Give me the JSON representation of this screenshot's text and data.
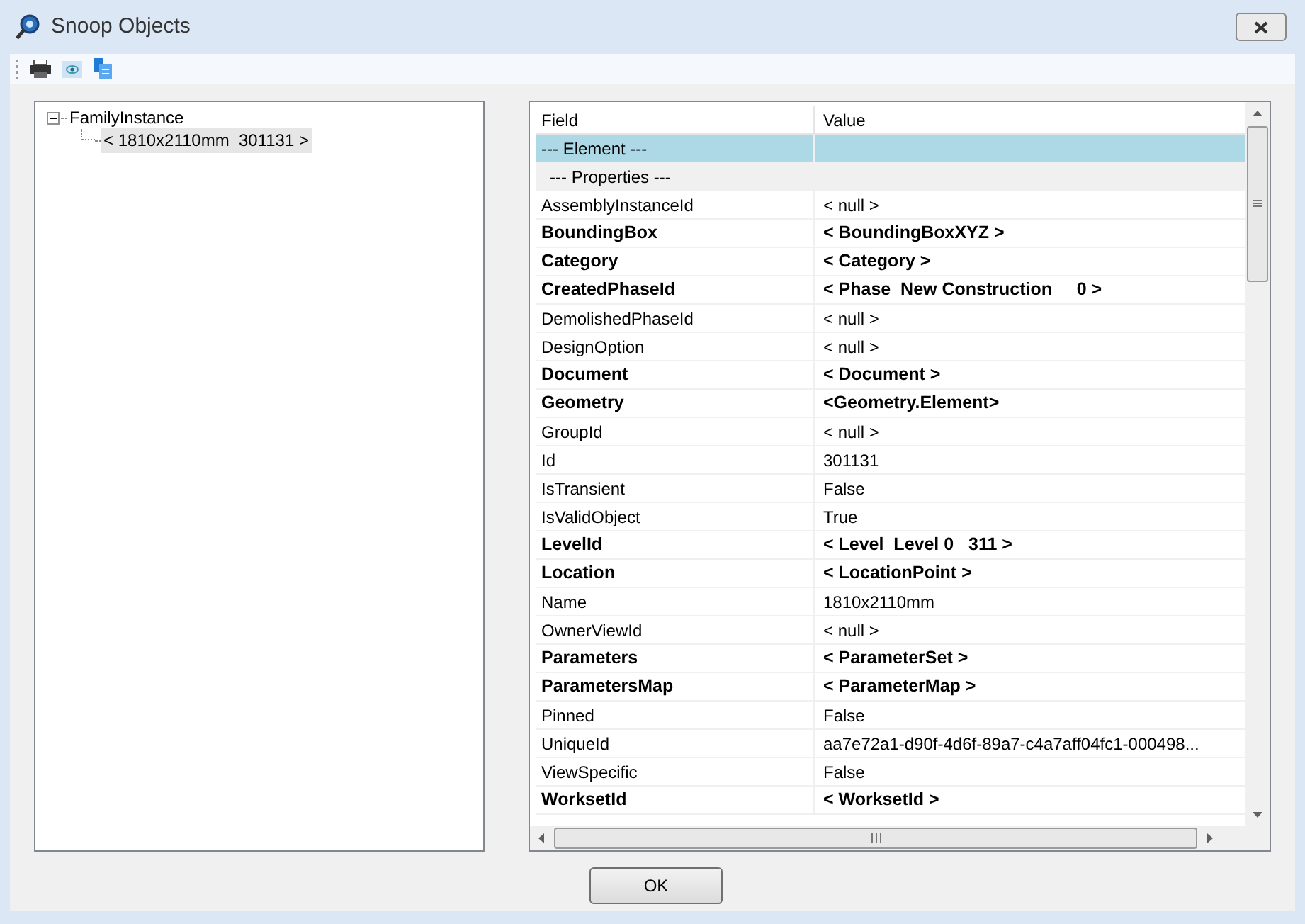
{
  "window": {
    "title": "Snoop Objects"
  },
  "tree": [
    {
      "label": "FamilyInstance",
      "expanded": true,
      "selected": false,
      "children": [
        {
          "label": "< 1810x2110mm  301131 >",
          "selected": true
        }
      ]
    }
  ],
  "table": {
    "columns": [
      "Field",
      "Value"
    ],
    "rows": [
      {
        "kind": "section",
        "selected": true,
        "field": "--- Element ---",
        "value": ""
      },
      {
        "kind": "subsection",
        "selected": false,
        "field": "--- Properties ---",
        "value": ""
      },
      {
        "kind": "plain",
        "selected": false,
        "field": "AssemblyInstanceId",
        "value": "< null >"
      },
      {
        "kind": "object",
        "selected": false,
        "field": "BoundingBox",
        "value": "< BoundingBoxXYZ >"
      },
      {
        "kind": "object",
        "selected": false,
        "field": "Category",
        "value": "< Category >"
      },
      {
        "kind": "object",
        "selected": false,
        "field": "CreatedPhaseId",
        "value": "< Phase  New Construction     0 >"
      },
      {
        "kind": "plain",
        "selected": false,
        "field": "DemolishedPhaseId",
        "value": "< null >"
      },
      {
        "kind": "plain",
        "selected": false,
        "field": "DesignOption",
        "value": "< null >"
      },
      {
        "kind": "object",
        "selected": false,
        "field": "Document",
        "value": "< Document >"
      },
      {
        "kind": "object",
        "selected": false,
        "field": "Geometry",
        "value": "<Geometry.Element>"
      },
      {
        "kind": "plain",
        "selected": false,
        "field": "GroupId",
        "value": "< null >"
      },
      {
        "kind": "plain",
        "selected": false,
        "field": "Id",
        "value": "301131"
      },
      {
        "kind": "plain",
        "selected": false,
        "field": "IsTransient",
        "value": "False"
      },
      {
        "kind": "plain",
        "selected": false,
        "field": "IsValidObject",
        "value": "True"
      },
      {
        "kind": "object",
        "selected": false,
        "field": "LevelId",
        "value": "< Level  Level 0   311 >"
      },
      {
        "kind": "object",
        "selected": false,
        "field": "Location",
        "value": "< LocationPoint >"
      },
      {
        "kind": "plain",
        "selected": false,
        "field": "Name",
        "value": "1810x2110mm"
      },
      {
        "kind": "plain",
        "selected": false,
        "field": "OwnerViewId",
        "value": "< null >"
      },
      {
        "kind": "object",
        "selected": false,
        "field": "Parameters",
        "value": "< ParameterSet >"
      },
      {
        "kind": "object",
        "selected": false,
        "field": "ParametersMap",
        "value": "< ParameterMap >"
      },
      {
        "kind": "plain",
        "selected": false,
        "field": "Pinned",
        "value": "False"
      },
      {
        "kind": "plain",
        "selected": false,
        "field": "UniqueId",
        "value": "aa7e72a1-d90f-4d6f-89a7-c4a7aff04fc1-000498..."
      },
      {
        "kind": "plain",
        "selected": false,
        "field": "ViewSpecific",
        "value": "False"
      },
      {
        "kind": "object",
        "selected": false,
        "field": "WorksetId",
        "value": "< WorksetId >"
      }
    ]
  },
  "buttons": [
    "OK"
  ]
}
